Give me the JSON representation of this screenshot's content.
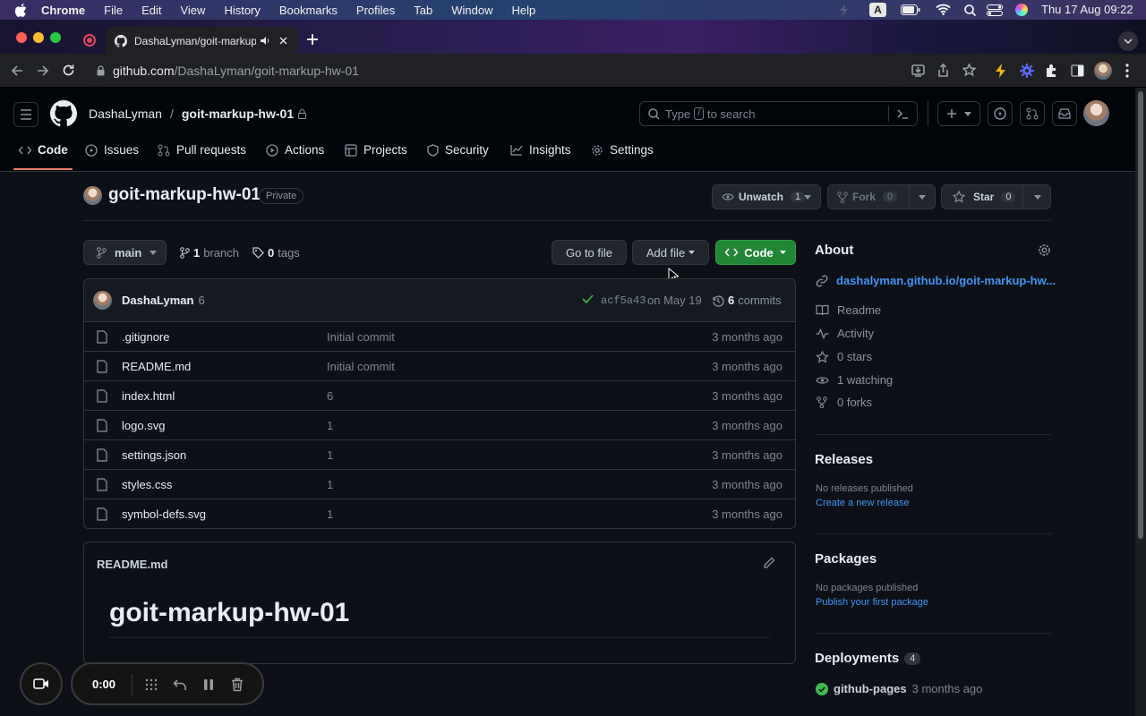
{
  "menubar": {
    "app": "Chrome",
    "items": [
      "File",
      "Edit",
      "View",
      "History",
      "Bookmarks",
      "Profiles",
      "Tab",
      "Window",
      "Help"
    ],
    "input_source": "A",
    "datetime": "Thu 17 Aug  09:22"
  },
  "browser": {
    "tab_title": "DashaLyman/goit-markup-",
    "url_host": "github.com",
    "url_path": "/DashaLyman/goit-markup-hw-01"
  },
  "github": {
    "owner": "DashaLyman",
    "repo": "goit-markup-hw-01",
    "search_prefix": "Type",
    "search_key": "/",
    "search_suffix": "to search",
    "nav": {
      "code": "Code",
      "issues": "Issues",
      "pulls": "Pull requests",
      "actions": "Actions",
      "projects": "Projects",
      "security": "Security",
      "insights": "Insights",
      "settings": "Settings"
    },
    "header": {
      "repo_title": "goit-markup-hw-01",
      "visibility": "Private",
      "unwatch_label": "Unwatch",
      "watch_count": "1",
      "fork_label": "Fork",
      "fork_count": "0",
      "star_label": "Star",
      "star_count": "0"
    },
    "branchbar": {
      "branch": "main",
      "branch_count": "1",
      "branch_label": "branch",
      "tag_count": "0",
      "tag_label": "tags",
      "go_to_file": "Go to file",
      "add_file": "Add file",
      "code": "Code"
    },
    "commit": {
      "author": "DashaLyman",
      "message": "6",
      "sha": "acf5a43",
      "date": "on May 19",
      "commit_count": "6",
      "commits_label": "commits"
    },
    "files": [
      {
        "name": ".gitignore",
        "message": "Initial commit",
        "time": "3 months ago"
      },
      {
        "name": "README.md",
        "message": "Initial commit",
        "time": "3 months ago"
      },
      {
        "name": "index.html",
        "message": "6",
        "time": "3 months ago"
      },
      {
        "name": "logo.svg",
        "message": "1",
        "time": "3 months ago"
      },
      {
        "name": "settings.json",
        "message": "1",
        "time": "3 months ago"
      },
      {
        "name": "styles.css",
        "message": "1",
        "time": "3 months ago"
      },
      {
        "name": "symbol-defs.svg",
        "message": "1",
        "time": "3 months ago"
      }
    ],
    "readme": {
      "filename": "README.md",
      "heading": "goit-markup-hw-01"
    },
    "about": {
      "title": "About",
      "link": "dashalyman.github.io/goit-markup-hw...",
      "readme": "Readme",
      "activity": "Activity",
      "stars": "0 stars",
      "watching": "1 watching",
      "forks": "0 forks"
    },
    "releases": {
      "title": "Releases",
      "empty": "No releases published",
      "create": "Create a new release"
    },
    "packages": {
      "title": "Packages",
      "empty": "No packages published",
      "publish": "Publish your first package"
    },
    "deployments": {
      "title": "Deployments",
      "count": "4",
      "item": "github-pages",
      "item_time": "3 months ago"
    }
  },
  "recorder": {
    "time": "0:00"
  },
  "colors": {
    "accent_green": "#238636",
    "link_blue": "#4493f8",
    "active_tab_underline": "#f78166"
  }
}
